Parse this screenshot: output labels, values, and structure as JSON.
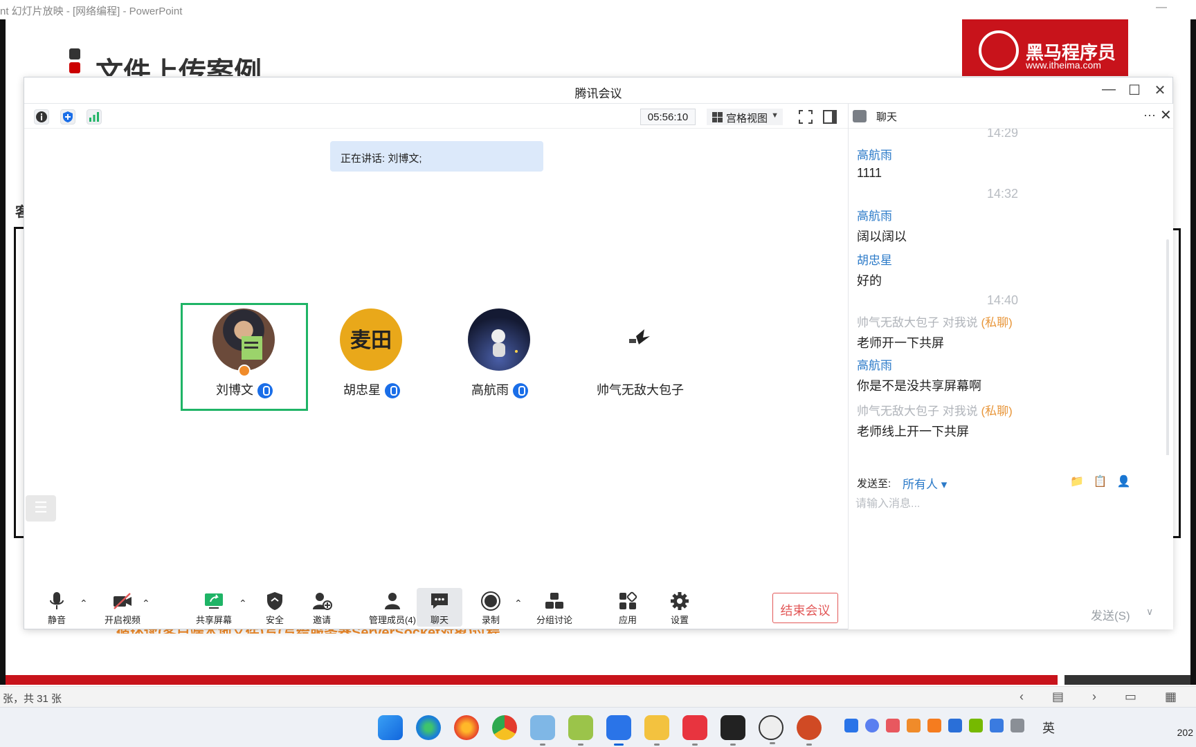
{
  "powerpoint": {
    "window_title": "nt 幻灯片放映 - [网络编程] - PowerPoint",
    "minimize": "—",
    "slide_title": "文件上传案例",
    "logo_main": "黑马程序员",
    "logo_url": "www.itheima.com",
    "side_char": "客",
    "orange_text": "循环读(客户端本地文件)写(写给服务器ServerSocket对象)过程",
    "status_pages": "张，共 31 张",
    "status_icons": "‹ ▤ › ▭ ▦"
  },
  "meeting": {
    "title": "腾讯会议",
    "window_controls": {
      "minimize": "—",
      "maximize": "☐",
      "close": "✕"
    },
    "timer": "05:56:10",
    "view_mode": "宫格视图",
    "speaking": "正在讲话: 刘博文;",
    "participants": [
      {
        "name": "刘博文",
        "active": true,
        "host": true,
        "mic": true
      },
      {
        "name": "胡忠星",
        "active": false,
        "host": false,
        "mic": true
      },
      {
        "name": "高航雨",
        "active": false,
        "host": false,
        "mic": true
      },
      {
        "name": "帅气无敌大包子",
        "active": false,
        "host": false,
        "mic": false
      }
    ],
    "controls": {
      "mute": "静音",
      "video": "开启视频",
      "share": "共享屏幕",
      "security": "安全",
      "invite": "邀请",
      "members": "管理成员(4)",
      "chat": "聊天",
      "record": "录制",
      "breakout": "分组讨论",
      "apps": "应用",
      "settings": "设置",
      "end": "结束会议"
    }
  },
  "chat": {
    "title": "聊天",
    "more": "···",
    "close": "✕",
    "times": [
      "14:29",
      "14:32",
      "14:40"
    ],
    "messages": [
      {
        "name": "高航雨",
        "text": "1111"
      },
      {
        "name": "高航雨",
        "text": "阔以阔以"
      },
      {
        "name": "胡忠星",
        "text": "好的"
      },
      {
        "name": "帅气无敌大包子",
        "to": "对我说",
        "private": "(私聊)",
        "text": "老师开一下共屏"
      },
      {
        "name": "高航雨",
        "text": "你是不是没共享屏幕啊"
      },
      {
        "name": "帅气无敌大包子",
        "to": "对我说",
        "private": "(私聊)",
        "text": "老师线上开一下共屏"
      }
    ],
    "send_to_label": "发送至:",
    "send_to_value": "所有人 ▾",
    "input_placeholder": "请输入消息...",
    "send_button": "发送(S)",
    "send_caret": "∨"
  },
  "taskbar": {
    "ime": "英",
    "clock": "202"
  },
  "colors": {
    "accent_blue": "#1a6ee8",
    "active_green": "#1fb466",
    "end_red": "#e25757",
    "name_blue": "#2b7ac8",
    "brand_red": "#c8131b"
  }
}
